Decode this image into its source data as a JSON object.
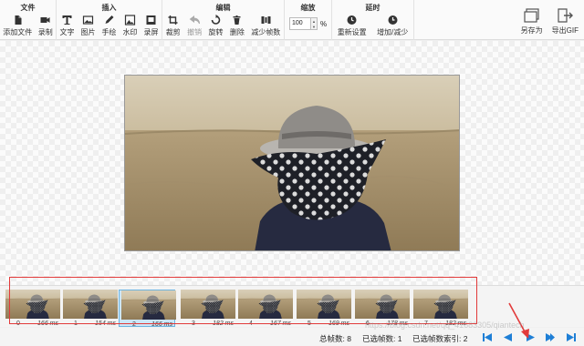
{
  "toolbar": {
    "groups": {
      "file": {
        "title": "文件",
        "add": "添加文件",
        "record": "录制"
      },
      "insert": {
        "title": "插入",
        "text": "文字",
        "image": "图片",
        "draw": "手绘",
        "watermark": "水印",
        "screen": "录屏"
      },
      "edit": {
        "title": "编辑",
        "crop": "裁剪",
        "undo": "撤销",
        "rotate": "旋转",
        "delete": "删除",
        "reduce": "减少帧数"
      },
      "zoom": {
        "title": "缩放",
        "value": "100",
        "unit": "%"
      },
      "delay": {
        "title": "延时",
        "reset": "重新设置",
        "adjust": "增加/减少"
      }
    },
    "save_as": "另存为",
    "export_gif": "导出GIF"
  },
  "frames": [
    {
      "index": "0",
      "duration": "166 ms"
    },
    {
      "index": "1",
      "duration": "154 ms"
    },
    {
      "index": "2",
      "duration": "166 ms"
    },
    {
      "index": "3",
      "duration": "182 ms"
    },
    {
      "index": "4",
      "duration": "167 ms"
    },
    {
      "index": "5",
      "duration": "169 ms"
    },
    {
      "index": "6",
      "duration": "178 ms"
    },
    {
      "index": "7",
      "duration": "182 ms"
    }
  ],
  "selected_frame": 2,
  "status": {
    "total_frames": "总帧数: 8",
    "selected_frames": "已选帧数: 1",
    "selected_index": "已选帧数索引: 2"
  },
  "watermark_text": "https://blog.csdn.net/qq_41683305/qiantech",
  "colors": {
    "accent": "#1e7fd6",
    "annotation": "#e23a3a",
    "selection": "#cce6f7"
  }
}
